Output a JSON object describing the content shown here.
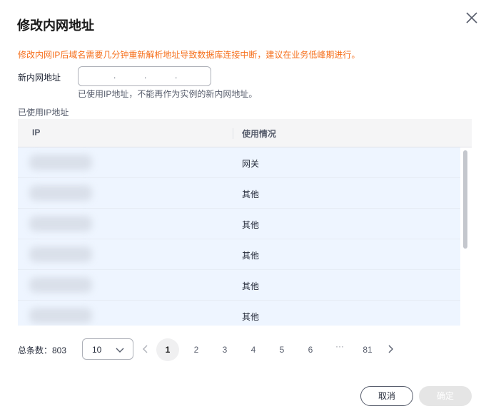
{
  "dialog": {
    "title": "修改内网地址",
    "warning": "修改内网IP后域名需要几分钟重新解析地址导致数据库连接中断，建议在业务低峰期进行。"
  },
  "form": {
    "label": "新内网地址",
    "segments": [
      "",
      "",
      "",
      ""
    ],
    "separators": [
      ".",
      ".",
      "."
    ],
    "hint": "已使用IP地址，不能再作为实例的新内网地址。"
  },
  "used_ips": {
    "label": "已使用IP地址",
    "columns": [
      "IP",
      "使用情况"
    ],
    "rows": [
      {
        "ip": "",
        "usage": "网关"
      },
      {
        "ip": "",
        "usage": "其他"
      },
      {
        "ip": "",
        "usage": "其他"
      },
      {
        "ip": "",
        "usage": "其他"
      },
      {
        "ip": "",
        "usage": "其他"
      },
      {
        "ip": "",
        "usage": "其他"
      }
    ]
  },
  "pagination": {
    "total_label": "总条数：803",
    "page_size": "10",
    "pages": [
      "1",
      "2",
      "3",
      "4",
      "5",
      "6",
      "81"
    ],
    "ellipsis": "···",
    "active_page": "1"
  },
  "footer": {
    "cancel_label": "取消",
    "ok_label": "确定"
  },
  "colors": {
    "warning": "#f66f1b",
    "row_bg": "#eef5ff",
    "header_bg": "#f5f5f6",
    "ok_disabled_bg": "#e5e5e5"
  },
  "icons": {
    "close": "close-icon",
    "select": "chevron-down-icon",
    "prev": "chevron-left-icon",
    "next": "chevron-right-icon"
  }
}
